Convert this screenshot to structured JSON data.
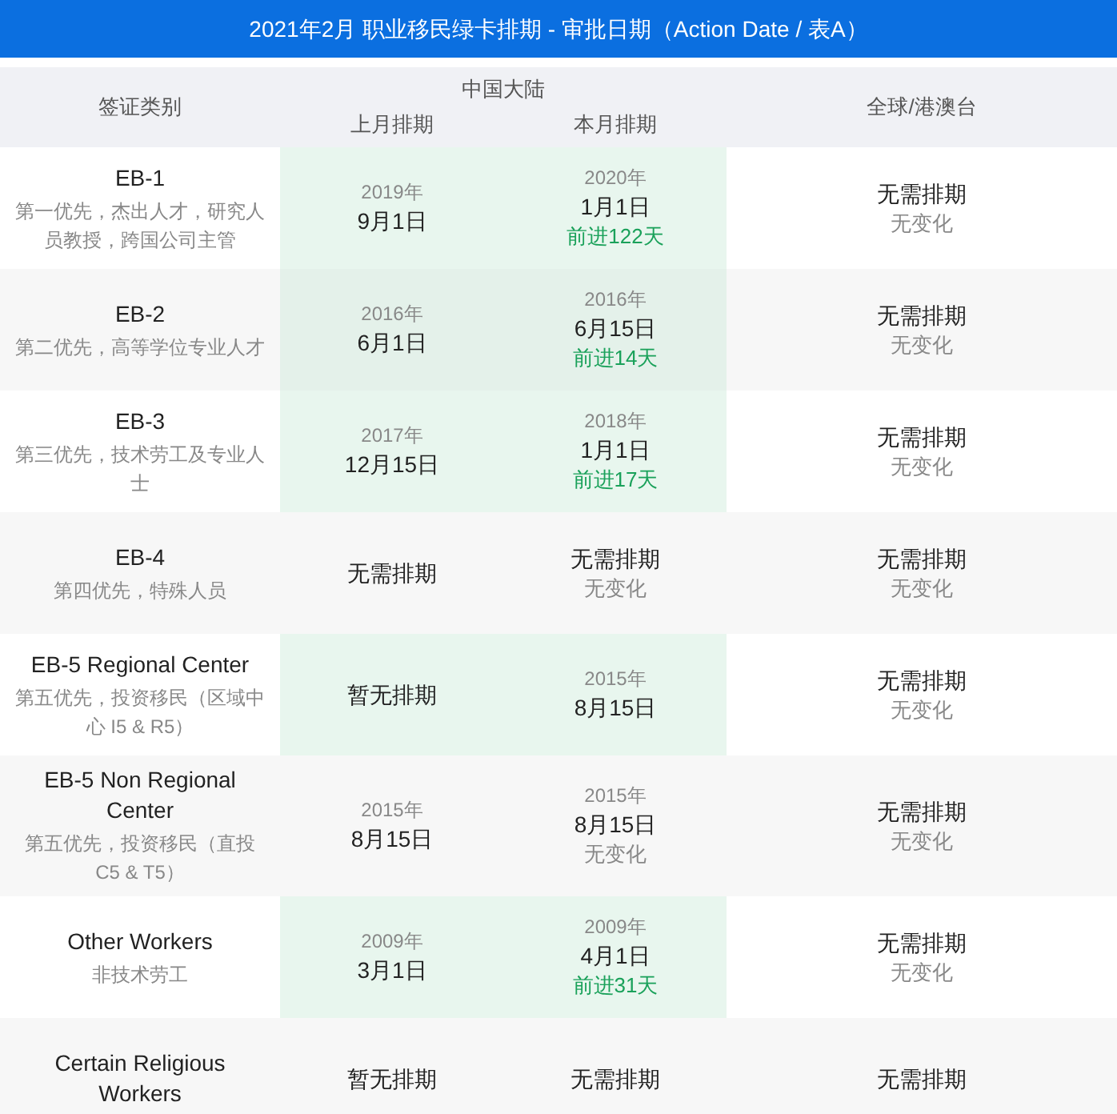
{
  "title": "2021年2月 职业移民绿卡排期 - 审批日期（Action Date / 表A）",
  "header": {
    "category": "签证类别",
    "china": "中国大陆",
    "china_last": "上月排期",
    "china_current": "本月排期",
    "global": "全球/港澳台"
  },
  "rows": [
    {
      "name": "EB-1",
      "desc": "第一优先，杰出人才，研究人员教授，跨国公司主管",
      "highlight": true,
      "last": {
        "year": "2019年",
        "date": "9月1日"
      },
      "current": {
        "year": "2020年",
        "date": "1月1日",
        "note": "前进122天",
        "advanced": true
      },
      "global": {
        "date": "无需排期",
        "note": "无变化",
        "advanced": false
      }
    },
    {
      "name": "EB-2",
      "desc": "第二优先，高等学位专业人才",
      "highlight": true,
      "last": {
        "year": "2016年",
        "date": "6月1日"
      },
      "current": {
        "year": "2016年",
        "date": "6月15日",
        "note": "前进14天",
        "advanced": true
      },
      "global": {
        "date": "无需排期",
        "note": "无变化",
        "advanced": false
      }
    },
    {
      "name": "EB-3",
      "desc": "第三优先，技术劳工及专业人士",
      "highlight": true,
      "last": {
        "year": "2017年",
        "date": "12月15日"
      },
      "current": {
        "year": "2018年",
        "date": "1月1日",
        "note": "前进17天",
        "advanced": true
      },
      "global": {
        "date": "无需排期",
        "note": "无变化",
        "advanced": false
      }
    },
    {
      "name": "EB-4",
      "desc": "第四优先，特殊人员",
      "highlight": false,
      "last": {
        "date": "无需排期"
      },
      "current": {
        "date": "无需排期",
        "note": "无变化",
        "advanced": false
      },
      "global": {
        "date": "无需排期",
        "note": "无变化",
        "advanced": false
      }
    },
    {
      "name": "EB-5 Regional Center",
      "desc": "第五优先，投资移民（区域中心 I5 & R5）",
      "highlight": true,
      "last": {
        "date": "暂无排期"
      },
      "current": {
        "year": "2015年",
        "date": "8月15日"
      },
      "global": {
        "date": "无需排期",
        "note": "无变化",
        "advanced": false
      }
    },
    {
      "name": "EB-5 Non Regional Center",
      "desc": "第五优先，投资移民（直投 C5 & T5）",
      "highlight": false,
      "last": {
        "year": "2015年",
        "date": "8月15日"
      },
      "current": {
        "year": "2015年",
        "date": "8月15日",
        "note": "无变化",
        "advanced": false
      },
      "global": {
        "date": "无需排期",
        "note": "无变化",
        "advanced": false
      }
    },
    {
      "name": "Other Workers",
      "desc": "非技术劳工",
      "highlight": true,
      "last": {
        "year": "2009年",
        "date": "3月1日"
      },
      "current": {
        "year": "2009年",
        "date": "4月1日",
        "note": "前进31天",
        "advanced": true
      },
      "global": {
        "date": "无需排期",
        "note": "无变化",
        "advanced": false
      }
    },
    {
      "name": "Certain Religious Workers",
      "highlight": false,
      "last": {
        "date": "暂无排期"
      },
      "current": {
        "date": "无需排期"
      },
      "global": {
        "date": "无需排期"
      }
    }
  ]
}
